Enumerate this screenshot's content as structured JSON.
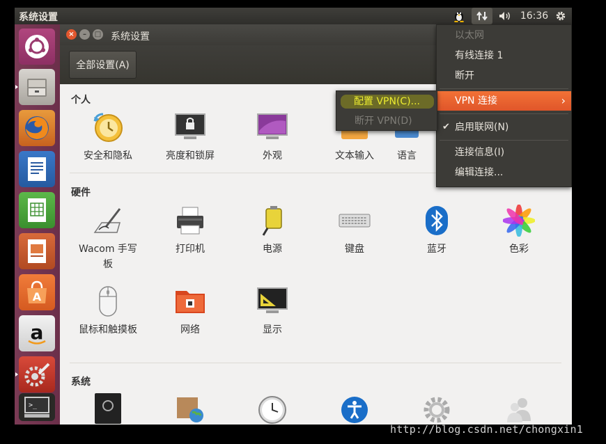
{
  "top_panel": {
    "title": "系统设置",
    "clock": "16:36"
  },
  "window": {
    "title": "系统设置",
    "all_settings_button": "全部设置(A)"
  },
  "sections": {
    "personal": {
      "title": "个人",
      "items": [
        "安全和隐私",
        "亮度和锁屏",
        "外观",
        "文本输入",
        "语言"
      ]
    },
    "hardware": {
      "title": "硬件",
      "items": [
        "Wacom 手写\n板",
        "打印机",
        "电源",
        "键盘",
        "蓝牙",
        "色彩",
        "鼠标和触摸板",
        "网络",
        "显示"
      ]
    },
    "system": {
      "title": "系统"
    }
  },
  "network_menu": {
    "ethernet_header": "以太网",
    "wired_connection": "有线连接 1",
    "disconnect": "断开",
    "vpn_connections": "VPN 连接",
    "enable_networking": "启用联网(N)",
    "connection_info": "连接信息(I)",
    "edit_connections": "编辑连接..."
  },
  "vpn_submenu": {
    "configure_vpn": "配置 VPN(C)...",
    "disconnect_vpn": "断开 VPN(D)"
  },
  "watermark": "http://blog.csdn.net/chongxin1",
  "colors": {
    "menu_highlight": "#e85d2b",
    "launcher": "#73344f",
    "yellow_highlight": "#e8e800"
  }
}
